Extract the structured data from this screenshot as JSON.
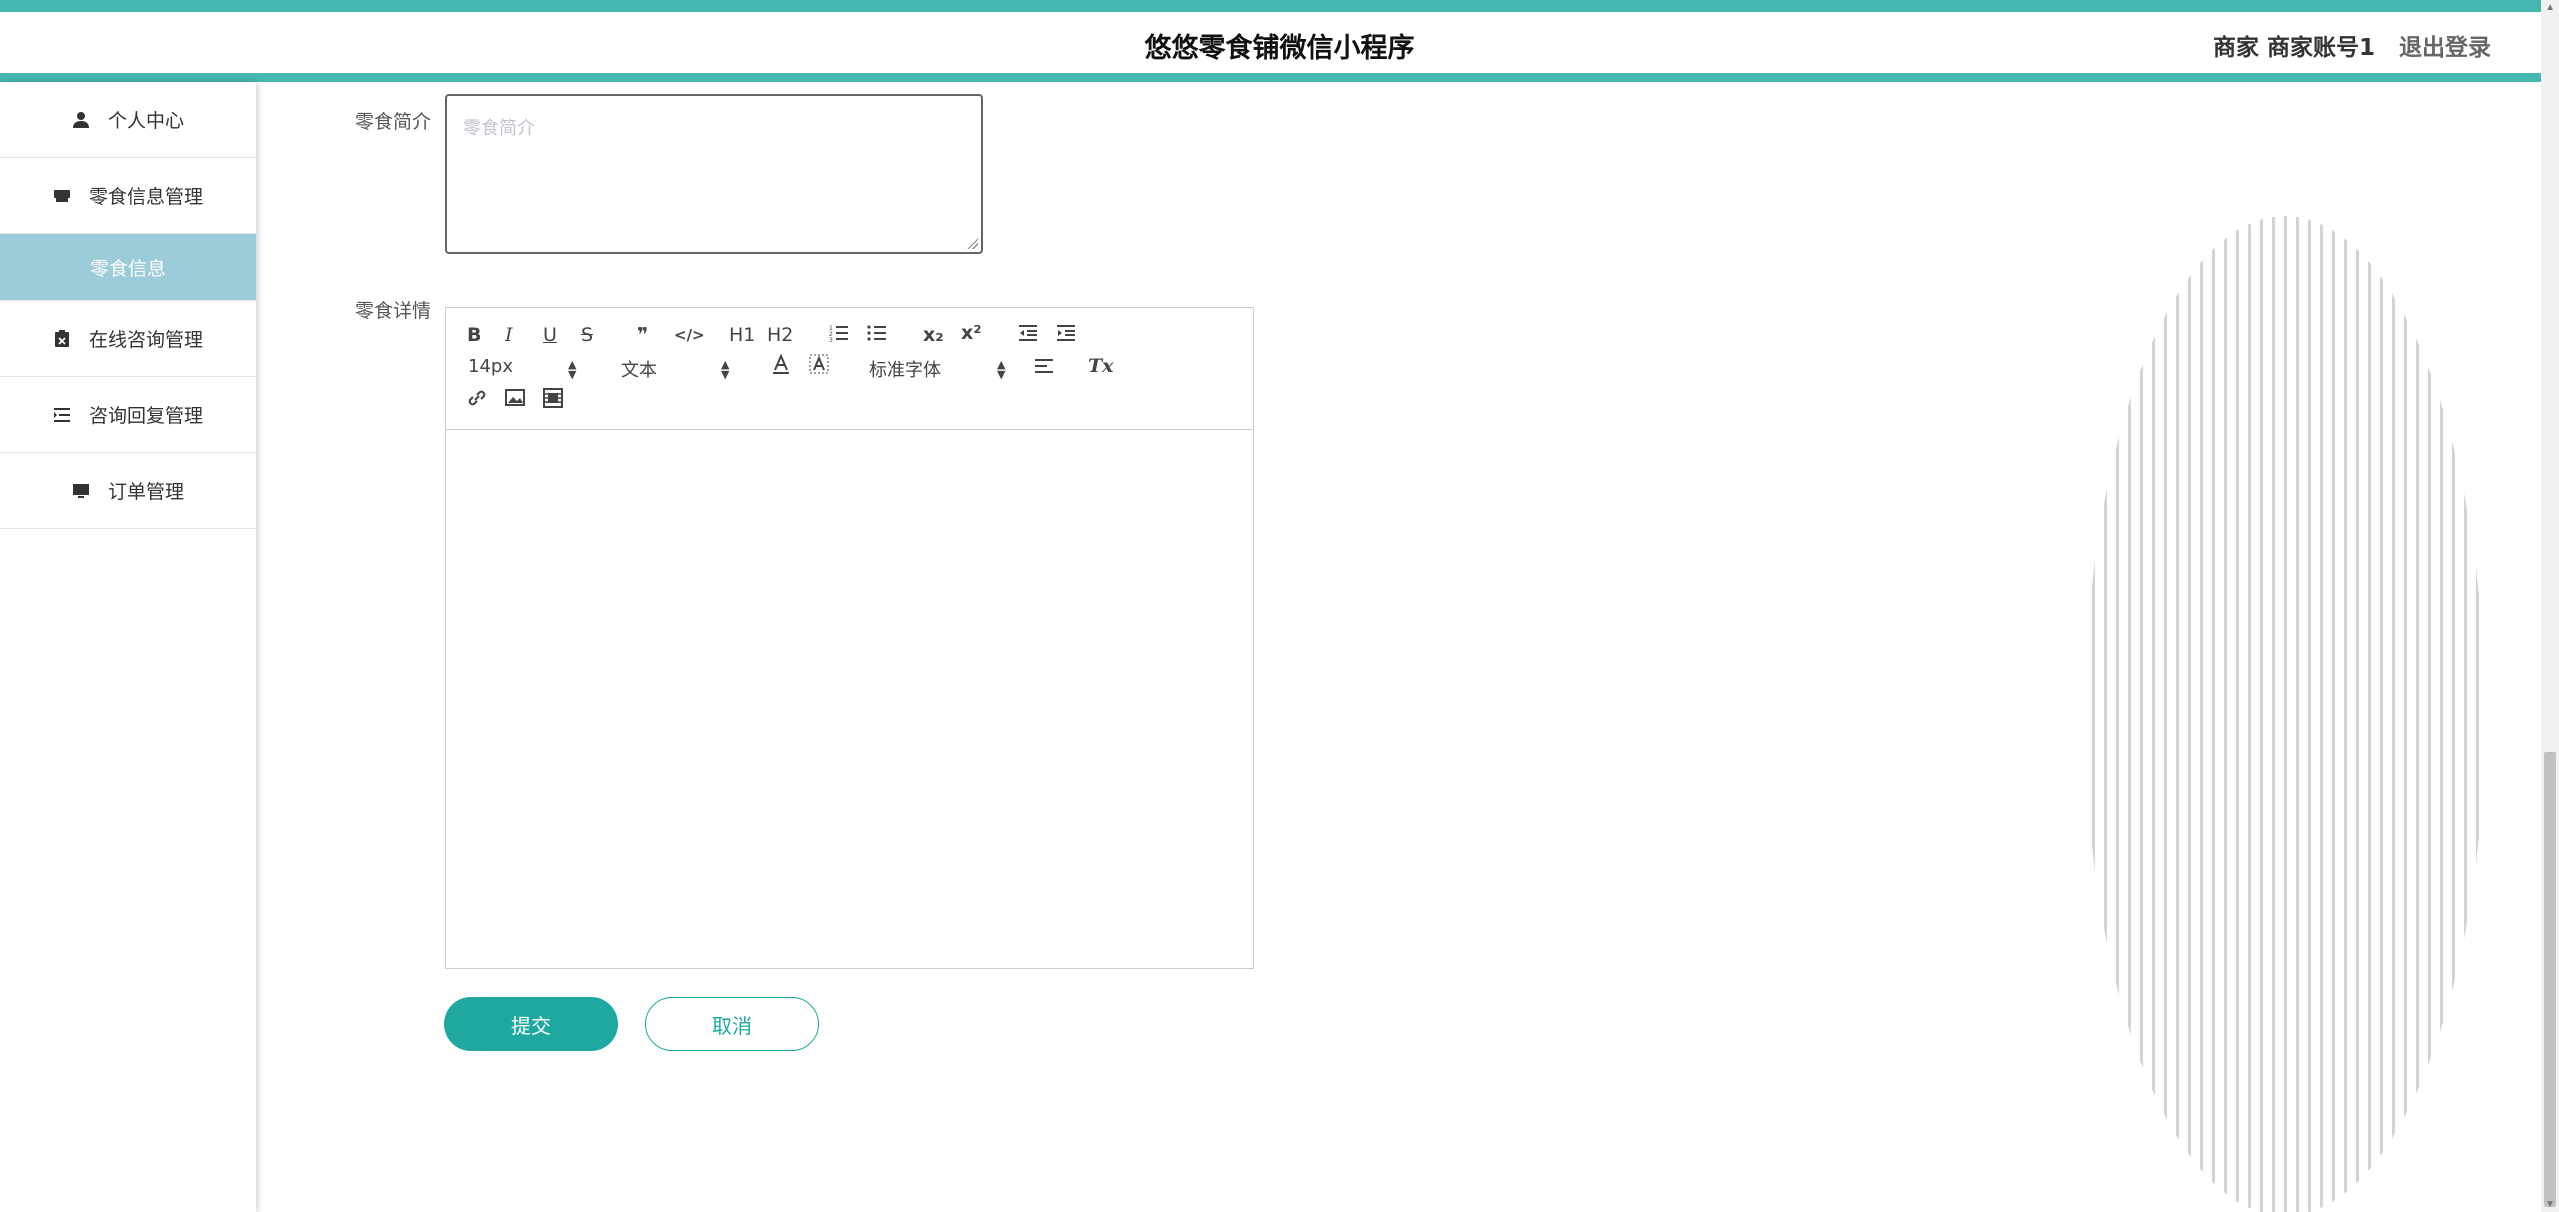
{
  "header": {
    "title": "悠悠零食铺微信小程序",
    "user_role": "商家 商家账号1",
    "logout": "退出登录"
  },
  "sidebar": {
    "items": [
      {
        "label": "个人中心",
        "icon": "user-icon"
      },
      {
        "label": "零食信息管理",
        "icon": "tray-icon"
      },
      {
        "label": "零食信息",
        "icon": "",
        "sub": true,
        "active": true
      },
      {
        "label": "在线咨询管理",
        "icon": "clipboard-icon"
      },
      {
        "label": "咨询回复管理",
        "icon": "list-indent-icon"
      },
      {
        "label": "订单管理",
        "icon": "monitor-icon"
      }
    ]
  },
  "form": {
    "intro_label": "零食简介",
    "intro_placeholder": "零食简介",
    "detail_label": "零食详情",
    "submit": "提交",
    "cancel": "取消"
  },
  "editor": {
    "bold": "B",
    "italic": "I",
    "underline": "U",
    "strike": "S",
    "quote": "❞",
    "code": "</>",
    "h1": "H1",
    "h2": "H2",
    "sub": "x₂",
    "sup": "x²",
    "clean": "Tx",
    "font_size": "14px",
    "header_style": "文本",
    "font_family": "标准字体"
  },
  "colors": {
    "accent": "#46b6b0",
    "button": "#1ea89f",
    "active_menu": "#9ccbd9"
  }
}
